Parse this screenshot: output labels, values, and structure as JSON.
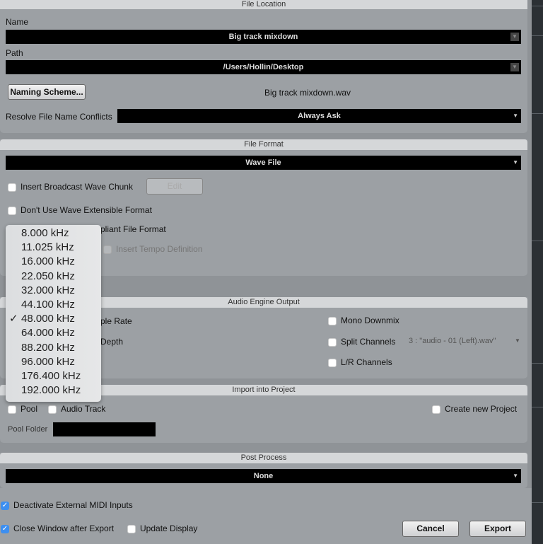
{
  "file_location": {
    "header": "File Location",
    "name_label": "Name",
    "name_value": "Big track mixdown",
    "path_label": "Path",
    "path_value": "/Users/Hollin/Desktop",
    "naming_scheme_button": "Naming Scheme...",
    "filename_preview": "Big track mixdown.wav",
    "resolve_label": "Resolve File Name Conflicts",
    "resolve_value": "Always Ask"
  },
  "file_format": {
    "header": "File Format",
    "format_value": "Wave File",
    "insert_bwc": "Insert Broadcast Wave Chunk",
    "edit_button": "Edit",
    "dont_use_wave_ext": "Don't Use Wave Extensible Format",
    "compliant_partial": "pliant File Format",
    "insert_tempo": "Insert Tempo Definition"
  },
  "sample_rate_menu": {
    "options": [
      "8.000 kHz",
      "11.025 kHz",
      "16.000 kHz",
      "22.050 kHz",
      "32.000 kHz",
      "44.100 kHz",
      "48.000 kHz",
      "64.000 kHz",
      "88.200 kHz",
      "96.000 kHz",
      "176.400 kHz",
      "192.000 kHz"
    ],
    "selected": "48.000 kHz",
    "check": "✓"
  },
  "audio_engine": {
    "header": "Audio Engine Output",
    "sample_rate_partial": "ple Rate",
    "bit_depth_partial": "Depth",
    "mono_downmix": "Mono Downmix",
    "split_channels": "Split Channels",
    "split_value": "3 : \"audio - 01 (Left).wav\"",
    "lr_channels": "L/R Channels"
  },
  "import": {
    "header": "Import into Project",
    "pool": "Pool",
    "audio_track": "Audio Track",
    "create_new_project": "Create new Project",
    "pool_folder_label": "Pool Folder",
    "pool_folder_value": ""
  },
  "post_process": {
    "header": "Post Process",
    "value": "None"
  },
  "footer": {
    "deactivate_midi": "Deactivate External MIDI Inputs",
    "close_window": "Close Window after Export",
    "update_display": "Update Display",
    "cancel": "Cancel",
    "export": "Export"
  },
  "colors": {
    "checkbox_on": "#3d8ff0",
    "panel": "#9ca0a4",
    "header": "#d5d7d9"
  }
}
